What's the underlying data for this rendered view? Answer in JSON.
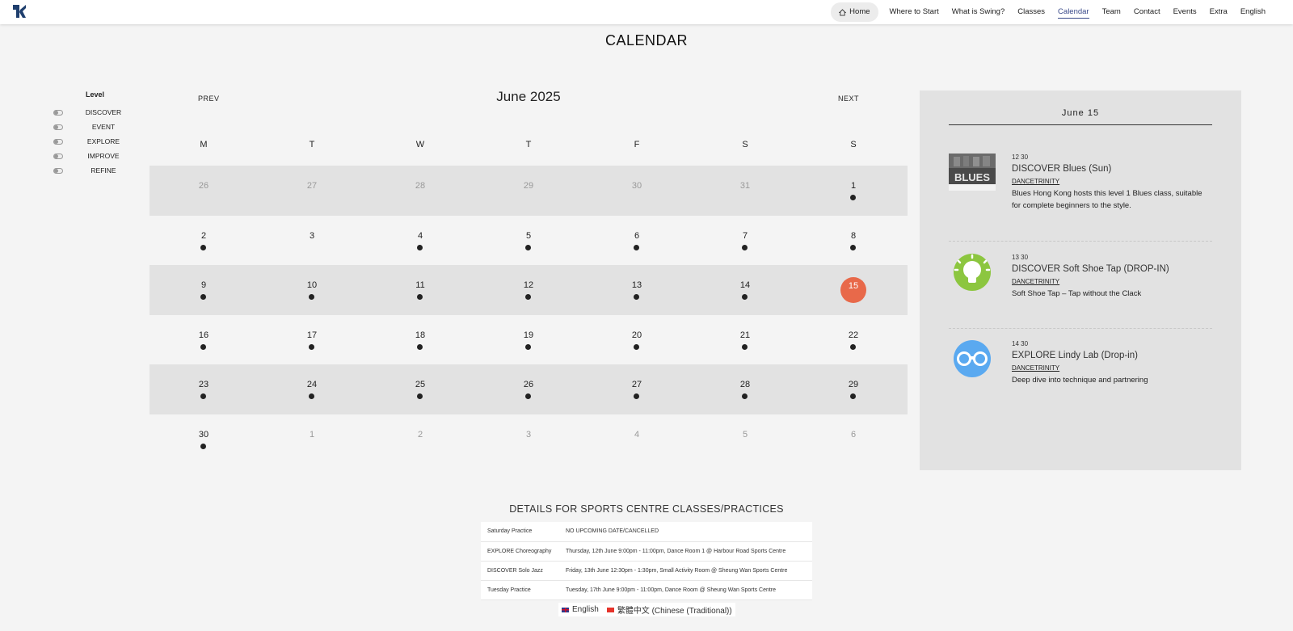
{
  "header": {
    "nav": [
      {
        "label": "Home",
        "home": true
      },
      {
        "label": "Where to Start"
      },
      {
        "label": "What is Swing?"
      },
      {
        "label": "Classes"
      },
      {
        "label": "Calendar",
        "active": true
      },
      {
        "label": "Team"
      },
      {
        "label": "Contact"
      },
      {
        "label": "Events"
      },
      {
        "label": "Extra"
      },
      {
        "label": "English"
      }
    ]
  },
  "page_title": "CALENDAR",
  "level_filter": {
    "title": "Level",
    "items": [
      "DISCOVER",
      "EVENT",
      "EXPLORE",
      "IMPROVE",
      "REFINE"
    ]
  },
  "calendar": {
    "prev_label": "PREV",
    "next_label": "NEXT",
    "month_title": "June 2025",
    "weekdays": [
      "M",
      "T",
      "W",
      "T",
      "F",
      "S",
      "S"
    ],
    "weeks": [
      [
        {
          "n": "26",
          "m": true
        },
        {
          "n": "27",
          "m": true
        },
        {
          "n": "28",
          "m": true
        },
        {
          "n": "29",
          "m": true
        },
        {
          "n": "30",
          "m": true
        },
        {
          "n": "31",
          "m": true
        },
        {
          "n": "1",
          "dot": true
        }
      ],
      [
        {
          "n": "2",
          "dot": true
        },
        {
          "n": "3"
        },
        {
          "n": "4",
          "dot": true
        },
        {
          "n": "5",
          "dot": true
        },
        {
          "n": "6",
          "dot": true
        },
        {
          "n": "7",
          "dot": true
        },
        {
          "n": "8",
          "dot": true
        }
      ],
      [
        {
          "n": "9",
          "dot": true
        },
        {
          "n": "10",
          "dot": true
        },
        {
          "n": "11",
          "dot": true
        },
        {
          "n": "12",
          "dot": true
        },
        {
          "n": "13",
          "dot": true
        },
        {
          "n": "14",
          "dot": true
        },
        {
          "n": "15",
          "today": true
        }
      ],
      [
        {
          "n": "16",
          "dot": true
        },
        {
          "n": "17",
          "dot": true
        },
        {
          "n": "18",
          "dot": true
        },
        {
          "n": "19",
          "dot": true
        },
        {
          "n": "20",
          "dot": true
        },
        {
          "n": "21",
          "dot": true
        },
        {
          "n": "22",
          "dot": true
        }
      ],
      [
        {
          "n": "23",
          "dot": true
        },
        {
          "n": "24",
          "dot": true
        },
        {
          "n": "25",
          "dot": true
        },
        {
          "n": "26",
          "dot": true
        },
        {
          "n": "27",
          "dot": true
        },
        {
          "n": "28",
          "dot": true
        },
        {
          "n": "29",
          "dot": true
        }
      ],
      [
        {
          "n": "30",
          "dot": true
        },
        {
          "n": "1",
          "m": true
        },
        {
          "n": "2",
          "m": true
        },
        {
          "n": "3",
          "m": true
        },
        {
          "n": "4",
          "m": true
        },
        {
          "n": "5",
          "m": true
        },
        {
          "n": "6",
          "m": true
        }
      ]
    ]
  },
  "sidebar": {
    "date": "June 15",
    "events": [
      {
        "time": "12 30",
        "title": "DISCOVER Blues (Sun)",
        "venue": "DANCETRINITY",
        "desc": "Blues Hong Kong hosts this level 1 Blues class, suitable for complete beginners to the style.",
        "image": "blues-poster",
        "image_text": "BLUES"
      },
      {
        "time": "13 30",
        "title": "DISCOVER Soft Shoe Tap (DROP-IN)",
        "venue": "DANCETRINITY",
        "desc": "Soft Shoe Tap – Tap without the Clack",
        "image": "lightbulb-icon"
      },
      {
        "time": "14 30",
        "title": "EXPLORE Lindy Lab (Drop-in)",
        "venue": "DANCETRINITY",
        "desc": "Deep dive into technique and partnering",
        "image": "goggles-icon"
      }
    ]
  },
  "details": {
    "title": "DETAILS FOR SPORTS CENTRE CLASSES/PRACTICES",
    "rows": [
      [
        "Saturday Practice",
        "NO UPCOMING DATE/CANCELLED"
      ],
      [
        "EXPLORE Choreography",
        "Thursday, 12th June 9:00pm - 11:00pm, Dance Room 1 @ Harbour Road Sports Centre"
      ],
      [
        "DISCOVER Solo Jazz",
        "Friday, 13th June 12:30pm - 1:30pm, Small Activity Room @ Sheung Wan Sports Centre"
      ],
      [
        "Tuesday Practice",
        "Tuesday, 17th June 9:00pm - 11:00pm, Dance Room @ Sheung Wan Sports Centre"
      ]
    ]
  },
  "languages": [
    {
      "label": "English",
      "flag": "uk-flag-icon"
    },
    {
      "label": "繁體中文 (Chinese (Traditional))",
      "flag": "hk-flag-icon"
    }
  ],
  "colors": {
    "accent_today": "#e8694a",
    "active_nav": "#3a4a8a",
    "lightbulb": "#8cc63f",
    "goggles": "#5aa9f0"
  }
}
